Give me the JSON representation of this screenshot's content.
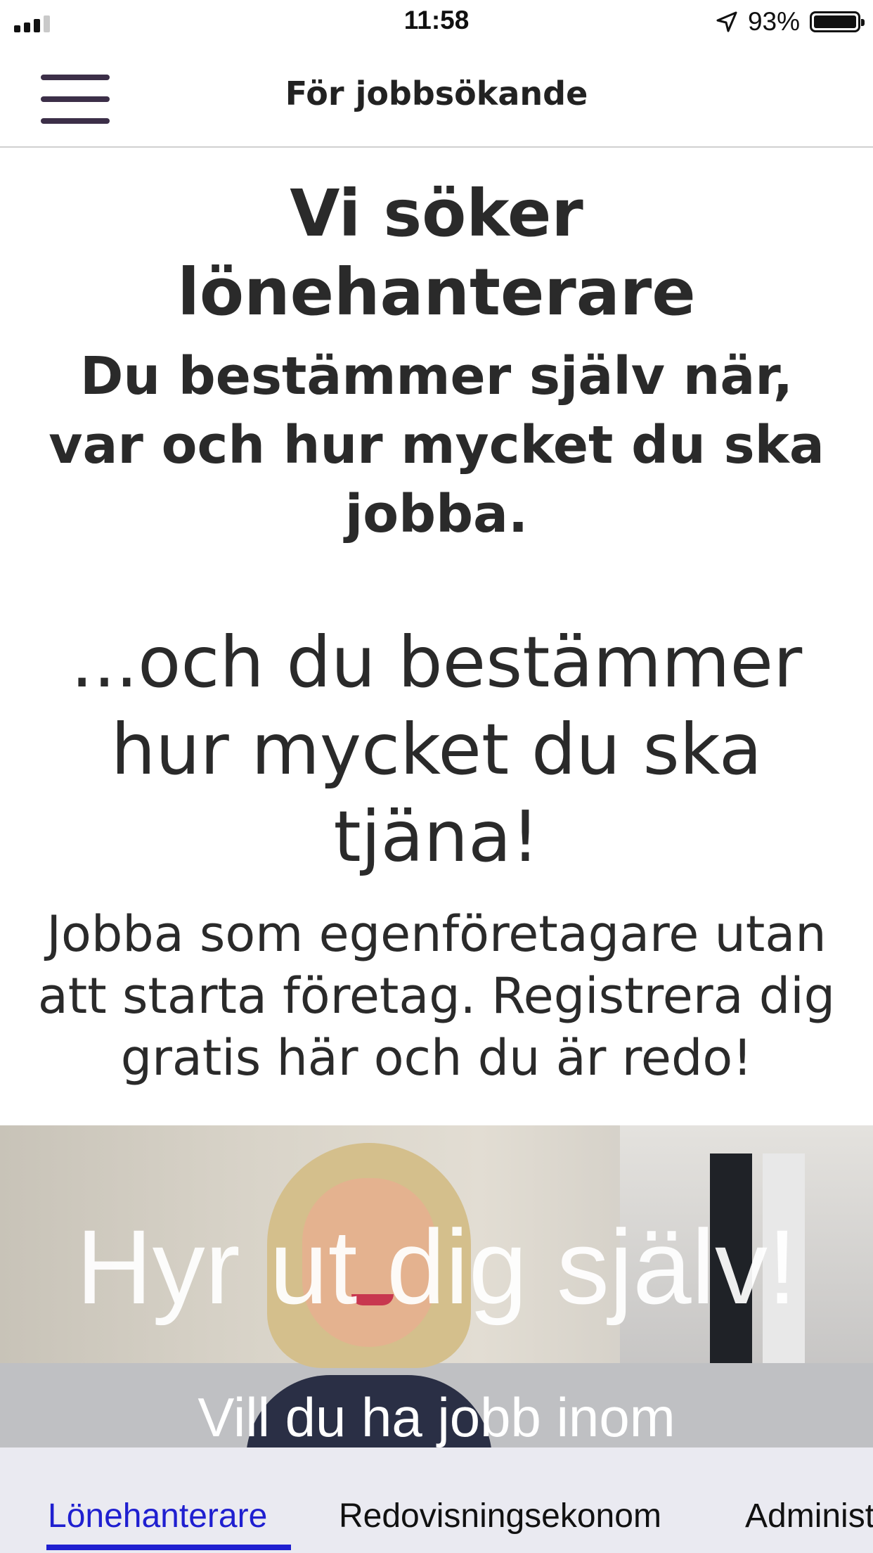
{
  "status_bar": {
    "time": "11:58",
    "battery": "93%"
  },
  "header": {
    "title": "För jobbsökande"
  },
  "content": {
    "heading": "Vi söker lönehanterare",
    "subheading": "Du bestämmer själv när, var och hur mycket du ska jobba.",
    "tagline": "...och du bestämmer hur mycket du ska tjäna!",
    "body": "Jobba som egenföretagare utan att starta företag. Registrera dig gratis här och du är redo!"
  },
  "hero": {
    "title": "Hyr ut dig själv!",
    "subtitle": "Vill du ha jobb inom"
  },
  "tabs": [
    {
      "label": "Lönehanterare",
      "active": true
    },
    {
      "label": "Redovisningsekonom",
      "active": false
    },
    {
      "label": "Administratör",
      "active": false
    }
  ],
  "colors": {
    "active_tab": "#1f1fd0",
    "menu_icon": "#3c2f48"
  }
}
